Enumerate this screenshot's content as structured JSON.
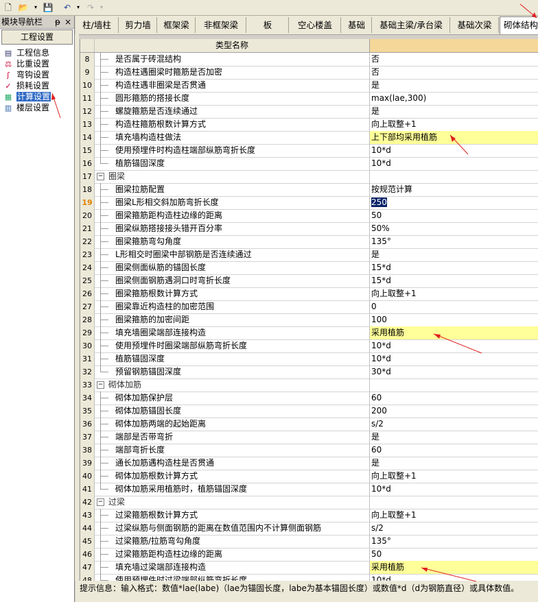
{
  "nav": {
    "title": "模块导航栏",
    "pin": "ᵽ",
    "close": "×",
    "tab": "工程设置",
    "items": [
      {
        "label": "工程信息",
        "icon": "info-icon"
      },
      {
        "label": "比重设置",
        "icon": "weight-icon"
      },
      {
        "label": "弯钩设置",
        "icon": "hook-icon"
      },
      {
        "label": "损耗设置",
        "icon": "loss-icon"
      },
      {
        "label": "计算设置",
        "icon": "calc-icon"
      },
      {
        "label": "楼层设置",
        "icon": "floor-icon"
      }
    ]
  },
  "tabs": [
    "柱/墙柱",
    "剪力墙",
    "框架梁",
    "非框架梁",
    "板",
    "空心楼盖",
    "基础",
    "基础主梁/承台梁",
    "基础次梁",
    "砌体结构"
  ],
  "grid": {
    "header_name": "类型名称",
    "rows": [
      {
        "n": "8",
        "name": "是否属于砖混结构",
        "value": "否"
      },
      {
        "n": "9",
        "name": "构造柱遇圈梁时箍筋是否加密",
        "value": "否"
      },
      {
        "n": "10",
        "name": "构造柱遇非圈梁是否贯通",
        "value": "是"
      },
      {
        "n": "11",
        "name": "圆形箍筋的搭接长度",
        "value": "max(lae,300)"
      },
      {
        "n": "12",
        "name": "螺旋箍筋是否连续通过",
        "value": "是"
      },
      {
        "n": "13",
        "name": "构造柱箍筋根数计算方式",
        "value": "向上取整+1"
      },
      {
        "n": "14",
        "name": "填充墙构造柱做法",
        "value": "上下部均采用植筋",
        "yellow": true
      },
      {
        "n": "15",
        "name": "使用预埋件时构造柱端部纵筋弯折长度",
        "value": "10*d"
      },
      {
        "n": "16",
        "name": "植筋锚固深度",
        "value": "10*d",
        "last": true
      },
      {
        "n": "17",
        "name": "圈梁",
        "value": "",
        "group": true
      },
      {
        "n": "18",
        "name": "圈梁拉筋配置",
        "value": "按规范计算"
      },
      {
        "n": "19",
        "name": "圈梁L形相交斜加筋弯折长度",
        "value": "250",
        "selected": true
      },
      {
        "n": "20",
        "name": "圈梁箍筋距构造柱边缘的距离",
        "value": "50"
      },
      {
        "n": "21",
        "name": "圈梁纵筋搭接接头错开百分率",
        "value": "50%"
      },
      {
        "n": "22",
        "name": "圈梁箍筋弯勾角度",
        "value": "135°"
      },
      {
        "n": "23",
        "name": "L形相交时圈梁中部钢筋是否连续通过",
        "value": "是"
      },
      {
        "n": "24",
        "name": "圈梁侧面纵筋的锚固长度",
        "value": "15*d"
      },
      {
        "n": "25",
        "name": "圈梁侧面钢筋遇洞口时弯折长度",
        "value": "15*d"
      },
      {
        "n": "26",
        "name": "圈梁箍筋根数计算方式",
        "value": "向上取整+1"
      },
      {
        "n": "27",
        "name": "圈梁靠近构造柱的加密范围",
        "value": "0"
      },
      {
        "n": "28",
        "name": "圈梁箍筋的加密间距",
        "value": "100"
      },
      {
        "n": "29",
        "name": "填充墙圈梁端部连接构造",
        "value": "采用植筋",
        "yellow": true
      },
      {
        "n": "30",
        "name": "使用预埋件时圈梁端部纵筋弯折长度",
        "value": "10*d"
      },
      {
        "n": "31",
        "name": "植筋锚固深度",
        "value": "10*d"
      },
      {
        "n": "32",
        "name": "预留钢筋锚固深度",
        "value": "30*d",
        "last": true
      },
      {
        "n": "33",
        "name": "砌体加筋",
        "value": "",
        "group": true
      },
      {
        "n": "34",
        "name": "砌体加筋保护层",
        "value": "60"
      },
      {
        "n": "35",
        "name": "砌体加筋锚固长度",
        "value": "200"
      },
      {
        "n": "36",
        "name": "砌体加筋两端的起始距离",
        "value": "s/2"
      },
      {
        "n": "37",
        "name": "端部是否带弯折",
        "value": "是"
      },
      {
        "n": "38",
        "name": "端部弯折长度",
        "value": "60"
      },
      {
        "n": "39",
        "name": "通长加筋遇构造柱是否贯通",
        "value": "是"
      },
      {
        "n": "40",
        "name": "砌体加筋根数计算方式",
        "value": "向上取整+1"
      },
      {
        "n": "41",
        "name": "砌体加筋采用植筋时，植筋锚固深度",
        "value": "10*d",
        "last": true
      },
      {
        "n": "42",
        "name": "过梁",
        "value": "",
        "group": true
      },
      {
        "n": "43",
        "name": "过梁箍筋根数计算方式",
        "value": "向上取整+1"
      },
      {
        "n": "44",
        "name": "过梁纵筋与侧面钢筋的距离在数值范围内不计算侧面钢筋",
        "value": "s/2"
      },
      {
        "n": "45",
        "name": "过梁箍筋/拉筋弯勾角度",
        "value": "135°"
      },
      {
        "n": "46",
        "name": "过梁箍筋距构造柱边缘的距离",
        "value": "50"
      },
      {
        "n": "47",
        "name": "填充墙过梁端部连接构造",
        "value": "采用植筋",
        "yellow": true
      },
      {
        "n": "48",
        "name": "使用预埋件时过梁端部纵筋弯折长度",
        "value": "10*d"
      }
    ]
  },
  "status": "提示信息：输入格式：数值*lae(labe)（lae为锚固长度，labe为基本锚固长度）或数值*d（d为钢筋直径）或具体数值。",
  "colors": {
    "highlight_yellow": "#ffff99",
    "header_value": "#f5d79a",
    "annotation_red": "#e02020",
    "selection": "#0a246a"
  }
}
